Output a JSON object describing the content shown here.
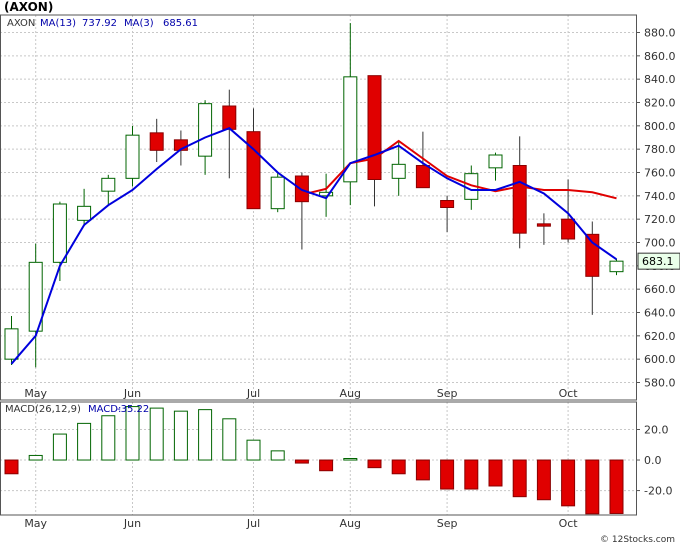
{
  "chart_data": [
    {
      "type": "candlestick",
      "title": "(AXON)",
      "legend": {
        "ticker": "AXON",
        "ma13_label": "MA(13)",
        "ma13_value": "737.92",
        "ma3_label": "MA(3)",
        "ma3_value": "685.61"
      },
      "last_price_label": "683.1",
      "ylim": [
        565,
        895
      ],
      "yticks": [
        580,
        600,
        620,
        640,
        660,
        680,
        700,
        720,
        740,
        760,
        780,
        800,
        820,
        840,
        860,
        880
      ],
      "xlabels": [
        "May",
        "Jun",
        "Jul",
        "Aug",
        "Sep",
        "Oct"
      ],
      "xlabel_index": [
        1,
        5,
        10,
        14,
        18,
        23
      ],
      "colors": {
        "up_fill": "#ffffff",
        "up_stroke": "#006400",
        "down": "#e00000",
        "ma13": "#e00000",
        "ma3": "#0000dd"
      },
      "candles": [
        {
          "o": 600,
          "h": 637,
          "l": 595,
          "c": 626
        },
        {
          "o": 624,
          "h": 699,
          "l": 593,
          "c": 683
        },
        {
          "o": 683,
          "h": 735,
          "l": 667,
          "c": 733
        },
        {
          "o": 719,
          "h": 746,
          "l": 714,
          "c": 731
        },
        {
          "o": 744,
          "h": 758,
          "l": 732,
          "c": 755
        },
        {
          "o": 755,
          "h": 800,
          "l": 748,
          "c": 792
        },
        {
          "o": 794,
          "h": 806,
          "l": 769,
          "c": 779
        },
        {
          "o": 788,
          "h": 796,
          "l": 766,
          "c": 779
        },
        {
          "o": 774,
          "h": 822,
          "l": 758,
          "c": 819
        },
        {
          "o": 817,
          "h": 831,
          "l": 755,
          "c": 797
        },
        {
          "o": 795,
          "h": 815,
          "l": 756,
          "c": 729
        },
        {
          "o": 729,
          "h": 760,
          "l": 726,
          "c": 756
        },
        {
          "o": 757,
          "h": 760,
          "l": 694,
          "c": 735
        },
        {
          "o": 740,
          "h": 759,
          "l": 722,
          "c": 743
        },
        {
          "o": 752,
          "h": 888,
          "l": 732,
          "c": 842
        },
        {
          "o": 843,
          "h": 843,
          "l": 731,
          "c": 754
        },
        {
          "o": 755,
          "h": 787,
          "l": 740,
          "c": 767
        },
        {
          "o": 766,
          "h": 795,
          "l": 748,
          "c": 747
        },
        {
          "o": 736,
          "h": 740,
          "l": 709,
          "c": 730
        },
        {
          "o": 737,
          "h": 766,
          "l": 728,
          "c": 759
        },
        {
          "o": 764,
          "h": 777,
          "l": 753,
          "c": 775
        },
        {
          "o": 766,
          "h": 791,
          "l": 695,
          "c": 708
        },
        {
          "o": 716,
          "h": 725,
          "l": 698,
          "c": 714
        },
        {
          "o": 720,
          "h": 754,
          "l": 700,
          "c": 703
        },
        {
          "o": 707,
          "h": 718,
          "l": 638,
          "c": 671
        },
        {
          "o": 675,
          "h": 686,
          "l": 672,
          "c": 684
        }
      ],
      "ma13": [
        null,
        null,
        null,
        null,
        null,
        null,
        null,
        null,
        null,
        null,
        null,
        null,
        741,
        746,
        768,
        772,
        787,
        772,
        757,
        749,
        744,
        748,
        745,
        745,
        743,
        737.92
      ],
      "ma3": [
        596,
        620,
        680,
        715,
        732,
        745,
        763,
        780,
        790,
        798,
        780,
        760,
        745,
        738,
        768,
        775,
        783,
        768,
        755,
        745,
        745,
        752,
        742,
        725,
        700,
        685.61
      ]
    },
    {
      "type": "bar",
      "title": "MACD(26,12,9)",
      "legend": {
        "macd_label": "MACD(26,12,9)",
        "macd_value_label": "MACD:",
        "macd_value": "-35.22"
      },
      "ylim": [
        -36,
        38
      ],
      "yticks": [
        20,
        0,
        -20
      ],
      "ytick_labels": [
        "20.0",
        "0.0",
        "-20.0"
      ],
      "values": [
        -9,
        3,
        17,
        24,
        29,
        35,
        34,
        32,
        33,
        27,
        13,
        6,
        -2,
        -7,
        1,
        -5,
        -9,
        -13,
        -19,
        -19,
        -17,
        -24,
        -26,
        -30,
        -35.22,
        -35
      ]
    }
  ],
  "watermark": "© 12Stocks.com"
}
